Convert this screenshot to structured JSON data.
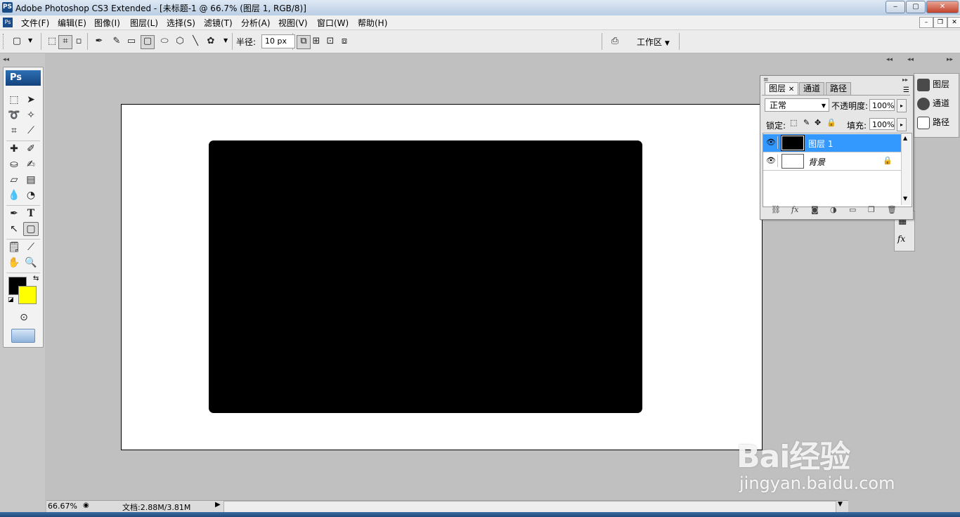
{
  "window": {
    "title": "Adobe Photoshop CS3 Extended - [未标题-1 @ 66.7% (图层 1, RGB/8)]",
    "app_icon": "PS",
    "controls": {
      "minimize": "‒",
      "maximize": "▢",
      "close": "✕"
    }
  },
  "menu": {
    "items": [
      "文件(F)",
      "编辑(E)",
      "图像(I)",
      "图层(L)",
      "选择(S)",
      "滤镜(T)",
      "分析(A)",
      "视图(V)",
      "窗口(W)",
      "帮助(H)"
    ],
    "doc_controls": {
      "minimize": "–",
      "restore": "❐",
      "close": "✕"
    }
  },
  "options_bar": {
    "radius_label": "半径:",
    "radius_value": "10 px",
    "workspace_label": "工作区"
  },
  "toolbox": {
    "logo": "Ps",
    "foreground_color": "#000000",
    "background_color": "#ffff00"
  },
  "canvas": {
    "background": "#ffffff",
    "shape_color": "#000000"
  },
  "layers_panel": {
    "tabs": [
      "图层",
      "通道",
      "路径"
    ],
    "blend_mode": "正常",
    "opacity_label": "不透明度:",
    "opacity_value": "100%",
    "lock_label": "锁定:",
    "fill_label": "填充:",
    "fill_value": "100%",
    "layers": [
      {
        "name": "图层 1",
        "selected": true,
        "thumb_color": "#000000"
      },
      {
        "name": "背景",
        "selected": false,
        "thumb_color": "#ffffff",
        "locked": true
      }
    ]
  },
  "dock": {
    "items": [
      "图层",
      "通道",
      "路径"
    ]
  },
  "status_bar": {
    "zoom": "66.67%",
    "doc_info": "文档:2.88M/3.81M"
  },
  "watermark": {
    "brand": "Bai经验",
    "url": "jingyan.baidu.com"
  }
}
